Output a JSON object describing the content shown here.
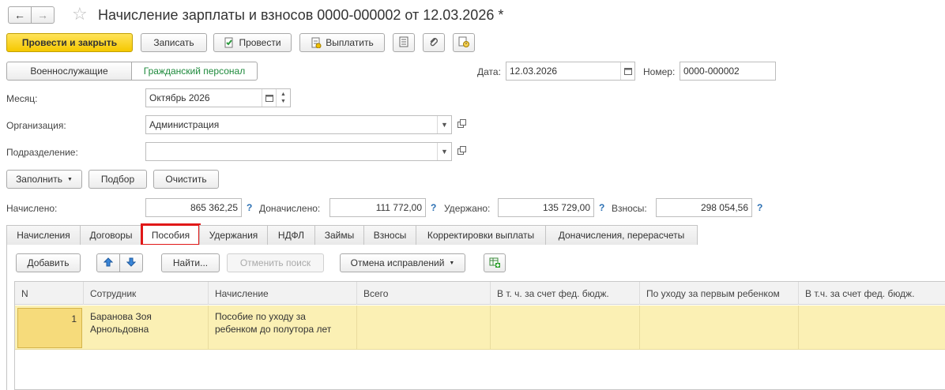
{
  "window": {
    "title": "Начисление зарплаты и взносов 0000-000002 от 12.03.2026 *"
  },
  "toolbar": {
    "post_close": "Провести и закрыть",
    "save": "Записать",
    "post": "Провести",
    "pay": "Выплатить"
  },
  "mode": {
    "military": "Военнослужащие",
    "civil": "Гражданский персонал"
  },
  "header": {
    "date_label": "Дата:",
    "date_value": "12.03.2026",
    "number_label": "Номер:",
    "number_value": "0000-000002"
  },
  "form": {
    "month_label": "Месяц:",
    "month_value": "Октябрь 2026",
    "org_label": "Организация:",
    "org_value": "Администрация",
    "dept_label": "Подразделение:",
    "dept_value": ""
  },
  "actions": {
    "fill": "Заполнить",
    "pick": "Подбор",
    "clear": "Очистить"
  },
  "totals": {
    "accrued_label": "Начислено:",
    "accrued_value": "865 362,25",
    "extra_label": "Доначислено:",
    "extra_value": "111 772,00",
    "withheld_label": "Удержано:",
    "withheld_value": "135 729,00",
    "contrib_label": "Взносы:",
    "contrib_value": "298 054,56",
    "help": "?"
  },
  "tabs": [
    {
      "label": "Начисления"
    },
    {
      "label": "Договоры"
    },
    {
      "label": "Пособия"
    },
    {
      "label": "Удержания"
    },
    {
      "label": "НДФЛ"
    },
    {
      "label": "Займы"
    },
    {
      "label": "Взносы"
    },
    {
      "label": "Корректировки выплаты"
    },
    {
      "label": "Доначисления, перерасчеты"
    }
  ],
  "table_toolbar": {
    "add": "Добавить",
    "find": "Найти...",
    "cancel_search": "Отменить поиск",
    "cancel_corrections": "Отмена исправлений"
  },
  "table": {
    "columns": [
      "N",
      "Сотрудник",
      "Начисление",
      "Всего",
      "В т. ч. за счет фед. бюдж.",
      "По уходу за первым ребенком",
      "В т.ч. за счет фед. бюдж."
    ],
    "rows": [
      {
        "n": "1",
        "employee_line1": "Баранова Зоя",
        "employee_line2": "Арнольдовна",
        "accrual_line1": "Пособие по уходу за",
        "accrual_line2": "ребенком до полутора лет",
        "total": "",
        "fed1": "",
        "first_child": "",
        "fed2": ""
      }
    ]
  },
  "colors": {
    "primary": "#f5c800",
    "row_selected": "#fbf0b4",
    "cell_active": "#f6db7b",
    "tab_highlight": "#e01818",
    "link_green": "#1e8a3c"
  }
}
